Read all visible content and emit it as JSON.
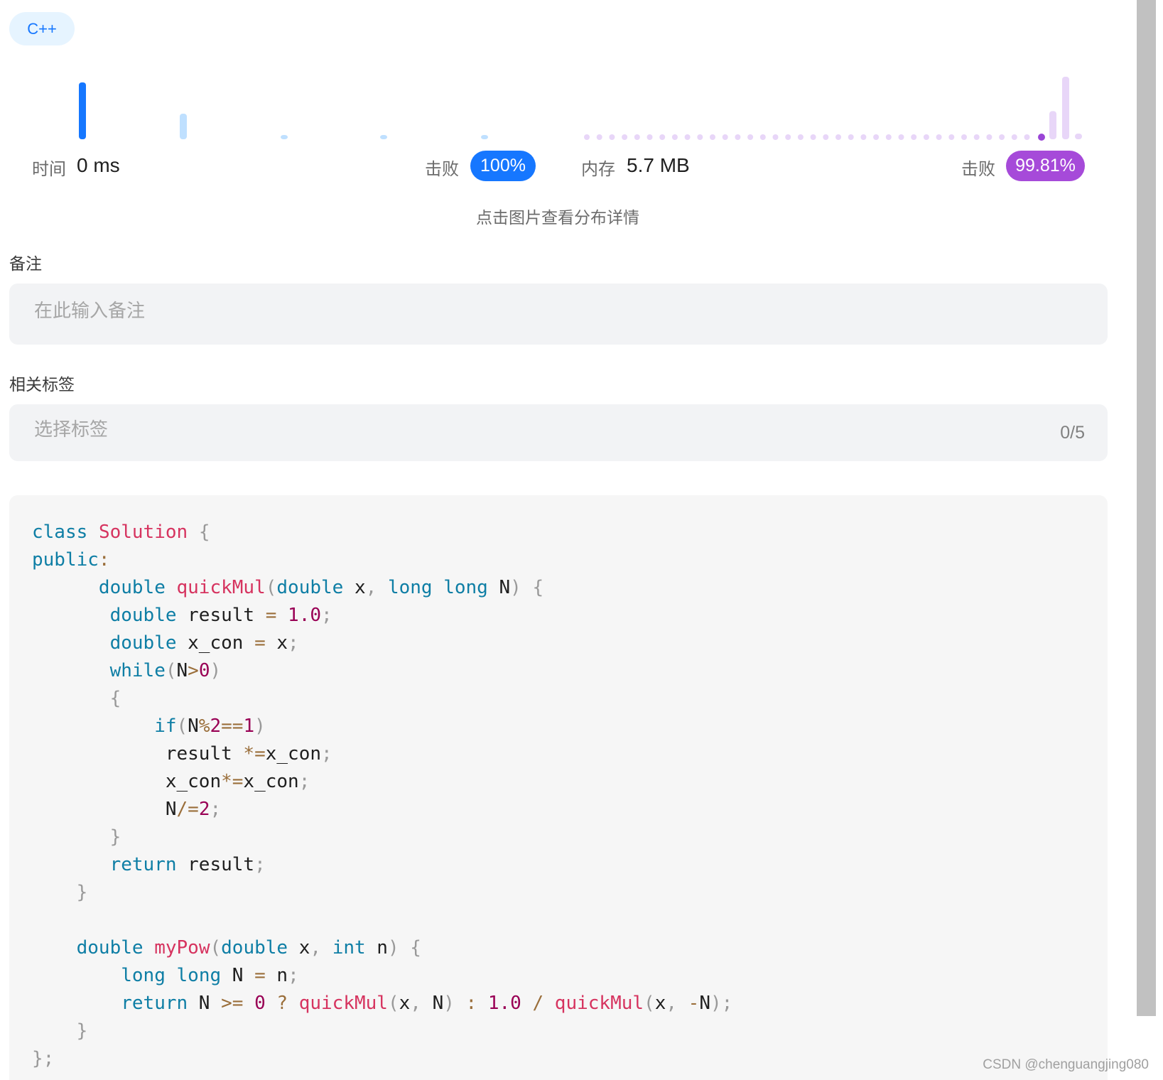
{
  "language_tag": "C++",
  "stats": {
    "time_label": "时间",
    "time_value": "0 ms",
    "time_beat_label": "击败",
    "time_beat_pct": "100%",
    "memory_label": "内存",
    "memory_value": "5.7 MB",
    "memory_beat_label": "击败",
    "memory_beat_pct": "99.81%"
  },
  "distribution": {
    "hint": "点击图片查看分布详情",
    "time_chart": {
      "values": [
        100,
        45,
        5,
        5,
        5
      ],
      "highlight_index": 0,
      "color": "#1677ff",
      "muted_color": "#bfe0ff"
    },
    "memory_chart": {
      "values_tail": [
        45,
        100,
        5
      ],
      "highlight_color": "#9a45d6",
      "muted_color": "#e8d6f8"
    }
  },
  "notes": {
    "label": "备注",
    "placeholder": "在此输入备注"
  },
  "tags": {
    "label": "相关标签",
    "placeholder": "选择标签",
    "counter": "0/5"
  },
  "code": {
    "language": "C++",
    "lines": [
      "class Solution {",
      "public:",
      "      double quickMul(double x, long long N) {",
      "       double result = 1.0;",
      "       double x_con = x;",
      "       while(N>0)",
      "       {",
      "           if(N%2==1)",
      "            result *=x_con;",
      "            x_con*=x_con;",
      "            N/=2;",
      "       }",
      "       return result;",
      "    }",
      "",
      "    double myPow(double x, int n) {",
      "        long long N = n;",
      "        return N >= 0 ? quickMul(x, N) : 1.0 / quickMul(x, -N);",
      "    }",
      "};"
    ]
  },
  "watermark": "CSDN @chenguangjing080"
}
